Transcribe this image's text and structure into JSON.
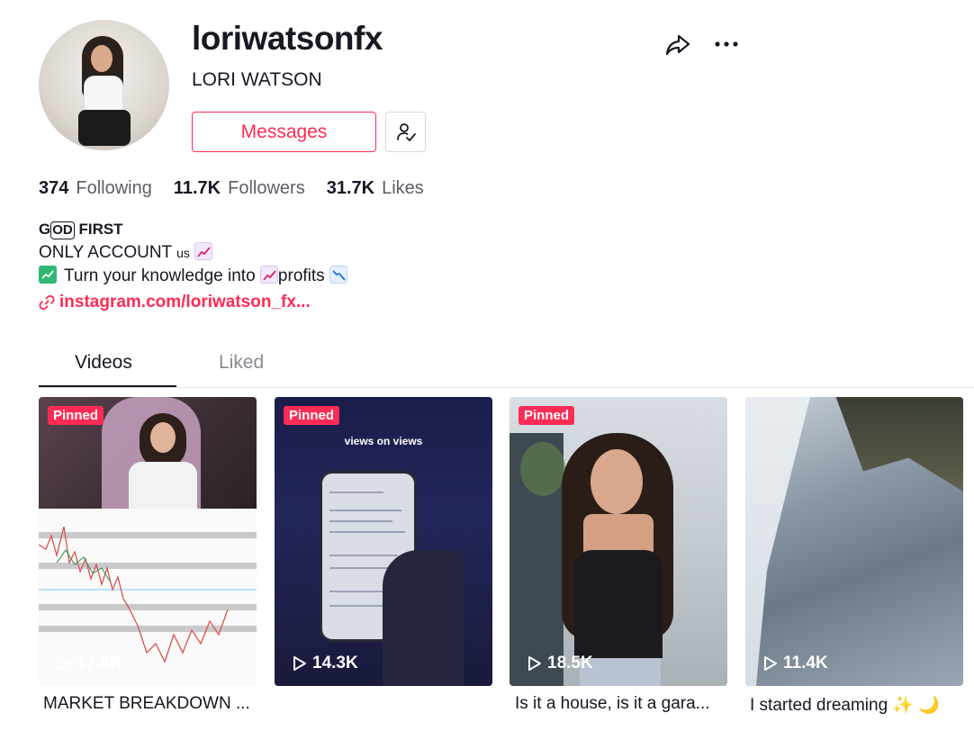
{
  "profile": {
    "username": "loriwatsonfx",
    "nickname": "LORI WATSON",
    "messages_label": "Messages"
  },
  "stats": {
    "following_count": "374",
    "following_label": "Following",
    "followers_count": "11.7K",
    "followers_label": "Followers",
    "likes_count": "31.7K",
    "likes_label": "Likes"
  },
  "bio": {
    "line1_pre": "G",
    "line1_boxed": "OD",
    "line1_post": " FIRST",
    "line2": "ONLY ACCOUNT ",
    "line2_small": "us",
    "line3_a": "Turn your knowledge into ",
    "line3_b": "profits "
  },
  "link": {
    "text": "instagram.com/loriwatson_fx..."
  },
  "tabs": [
    {
      "label": "Videos",
      "active": true
    },
    {
      "label": "Liked",
      "active": false
    }
  ],
  "videos": [
    {
      "pinned": "Pinned",
      "views": "17.8K",
      "caption": "MARKET BREAKDOWN ..."
    },
    {
      "pinned": "Pinned",
      "views": "14.3K",
      "caption": "",
      "overlay_text": "views on views"
    },
    {
      "pinned": "Pinned",
      "views": "18.5K",
      "caption": "Is it a house, is it a gara..."
    },
    {
      "pinned": "",
      "views": "11.4K",
      "caption": "I started dreaming ✨ 🌙"
    }
  ],
  "icons": {
    "share": "share-icon",
    "more": "more-icon",
    "follow": "user-check-icon",
    "link": "link-icon",
    "play": "play-icon"
  },
  "colors": {
    "accent": "#fe2c55",
    "text": "#161823",
    "muted": "#5d5e66"
  }
}
